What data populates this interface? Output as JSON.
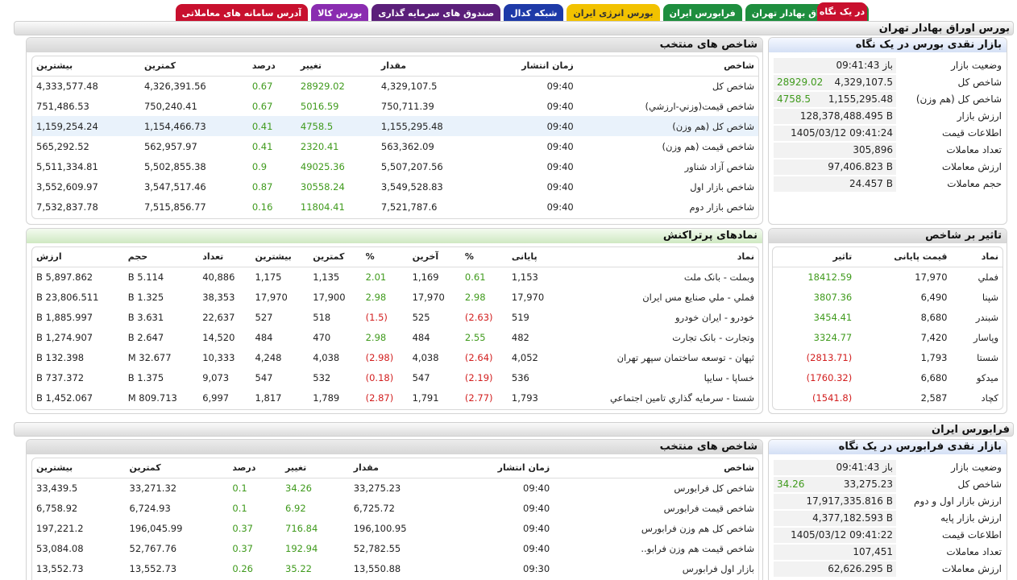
{
  "tabs": [
    "در یک نگاه",
    "بورس اوراق بهادار تهران",
    "فرابورس ایران",
    "بورس انرژی ایران",
    "شبکه کدال",
    "صندوق های سرمایه گذاری",
    "بورس کالا",
    "آدرس سامانه های معاملاتی"
  ],
  "tse": {
    "section_title": "بورس اوراق بهادار تهران",
    "glance_title": "بازار نقدی بورس در یک نگاه",
    "glance": [
      {
        "k": "وضعیت بازار",
        "v": "باز 09:41:43",
        "extra": ""
      },
      {
        "k": "شاخص کل",
        "v": "4,329,107.5",
        "extra": "28929.02"
      },
      {
        "k": "شاخص کل (هم وزن)",
        "v": "1,155,295.48",
        "extra": "4758.5"
      },
      {
        "k": "ارزش بازار",
        "v": "128,378,488.495 B",
        "extra": ""
      },
      {
        "k": "اطلاعات قیمت",
        "v": "1405/03/12 09:41:24",
        "extra": ""
      },
      {
        "k": "تعداد معاملات",
        "v": "305,896",
        "extra": ""
      },
      {
        "k": "ارزش معاملات",
        "v": "97,406.823 B",
        "extra": ""
      },
      {
        "k": "حجم معاملات",
        "v": "24.457 B",
        "extra": ""
      }
    ],
    "indices_title": "شاخص های منتخب",
    "indices_headers": [
      "شاخص",
      "زمان انتشار",
      "مقدار",
      "تغییر",
      "درصد",
      "کمترین",
      "بیشترین"
    ],
    "indices": [
      [
        "شاخص کل",
        "09:40",
        "4,329,107.5",
        "28929.02",
        "0.67",
        "4,326,391.56",
        "4,333,577.48"
      ],
      [
        "شاخص قیمت(وزني-ارزشي)",
        "09:40",
        "750,711.39",
        "5016.59",
        "0.67",
        "750,240.41",
        "751,486.53"
      ],
      [
        "شاخص کل (هم وزن)",
        "09:40",
        "1,155,295.48",
        "4758.5",
        "0.41",
        "1,154,466.73",
        "1,159,254.24"
      ],
      [
        "شاخص قیمت (هم وزن)",
        "09:40",
        "563,362.09",
        "2320.41",
        "0.41",
        "562,957.97",
        "565,292.52"
      ],
      [
        "شاخص آزاد شناور",
        "09:40",
        "5,507,207.56",
        "49025.36",
        "0.9",
        "5,502,855.38",
        "5,511,334.81"
      ],
      [
        "شاخص بازار اول",
        "09:40",
        "3,549,528.83",
        "30558.24",
        "0.87",
        "3,547,517.46",
        "3,552,609.97"
      ],
      [
        "شاخص بازار دوم",
        "09:40",
        "7,521,787.6",
        "11804.41",
        "0.16",
        "7,515,856.77",
        "7,532,837.78"
      ]
    ],
    "impact_title": "تاثیر بر شاخص",
    "impact_headers": [
      "نماد",
      "قیمت پایانی",
      "تاثیر"
    ],
    "impact": [
      [
        "فملي",
        "17,970",
        "18412.59"
      ],
      [
        "شپنا",
        "6,490",
        "3807.36"
      ],
      [
        "شبندر",
        "8,680",
        "3454.41"
      ],
      [
        "وپاسار",
        "7,420",
        "3324.77"
      ],
      [
        "شستا",
        "1,793",
        "(2813.71)"
      ],
      [
        "میدکو",
        "6,680",
        "(1760.32)"
      ],
      [
        "کچاد",
        "2,587",
        "(1541.8)"
      ]
    ],
    "active_title": "نمادهای پرتراکنش",
    "active_headers": [
      "نماد",
      "پایانی",
      "%",
      "آخرین",
      "%",
      "کمترین",
      "بیشترین",
      "تعداد",
      "حجم",
      "ارزش"
    ],
    "active": [
      [
        "وبملت - بانک ملت",
        "1,153",
        "0.61",
        "1,169",
        "2.01",
        "1,135",
        "1,175",
        "40,886",
        "5.114 B",
        "5,897.862 B"
      ],
      [
        "فملي - ملي صنايع مس ايران",
        "17,970",
        "2.98",
        "17,970",
        "2.98",
        "17,900",
        "17,970",
        "38,353",
        "1.325 B",
        "23,806.511 B"
      ],
      [
        "خودرو - ایران خودرو",
        "519",
        "(2.63)",
        "525",
        "(1.5)",
        "518",
        "527",
        "22,637",
        "3.631 B",
        "1,885.997 B"
      ],
      [
        "وتجارت - بانک تجارت",
        "482",
        "2.55",
        "484",
        "2.98",
        "470",
        "484",
        "14,520",
        "2.647 B",
        "1,274.907 B"
      ],
      [
        "ثپهان - توسعه ساختمان سپهر تهران",
        "4,052",
        "(2.64)",
        "4,038",
        "(2.98)",
        "4,038",
        "4,248",
        "10,333",
        "32.677 M",
        "132.398 B"
      ],
      [
        "خساپا - سایپا",
        "536",
        "(2.19)",
        "547",
        "(0.18)",
        "532",
        "547",
        "9,073",
        "1.375 B",
        "737.372 B"
      ],
      [
        "شستا - سرمايه گذاري تامين اجتماعي",
        "1,793",
        "(2.77)",
        "1,791",
        "(2.87)",
        "1,789",
        "1,817",
        "6,997",
        "809.713 M",
        "1,452.067 B"
      ]
    ]
  },
  "ifb": {
    "section_title": "فرابورس ایران",
    "glance_title": "بازار نقدی فرابورس در یک نگاه",
    "glance": [
      {
        "k": "وضعیت بازار",
        "v": "باز 09:41:43",
        "extra": ""
      },
      {
        "k": "شاخص کل",
        "v": "33,275.23",
        "extra": "34.26"
      },
      {
        "k": "ارزش بازار اول و دوم",
        "v": "17,917,335.816 B",
        "extra": ""
      },
      {
        "k": "ارزش بازار پایه",
        "v": "4,377,182.593 B",
        "extra": ""
      },
      {
        "k": "اطلاعات قیمت",
        "v": "1405/03/12 09:41:22",
        "extra": ""
      },
      {
        "k": "تعداد معاملات",
        "v": "107,451",
        "extra": ""
      },
      {
        "k": "ارزش معاملات",
        "v": "62,626.295 B",
        "extra": ""
      }
    ],
    "indices_title": "شاخص های منتخب",
    "indices_headers": [
      "شاخص",
      "زمان انتشار",
      "مقدار",
      "تغییر",
      "درصد",
      "کمترین",
      "بیشترین"
    ],
    "indices": [
      [
        "شاخص کل فرابورس",
        "09:40",
        "33,275.23",
        "34.26",
        "0.1",
        "33,271.32",
        "33,439.5"
      ],
      [
        "شاخص قیمت فرابورس",
        "09:40",
        "6,725.72",
        "6.92",
        "0.1",
        "6,724.93",
        "6,758.92"
      ],
      [
        "شاخص کل هم وزن فرابورس",
        "09:40",
        "196,100.95",
        "716.84",
        "0.37",
        "196,045.99",
        "197,221.2"
      ],
      [
        "شاخص قیمت هم وزن فرابو..",
        "09:40",
        "52,782.55",
        "192.94",
        "0.37",
        "52,767.76",
        "53,084.08"
      ],
      [
        "بازار اول فرابورس",
        "09:30",
        "13,550.88",
        "35.22",
        "0.26",
        "13,552.73",
        "13,552.73"
      ]
    ]
  },
  "colors": {
    "positive": "#3f9a1c",
    "negative": "#d21e1e",
    "accent": "#c8102e"
  }
}
